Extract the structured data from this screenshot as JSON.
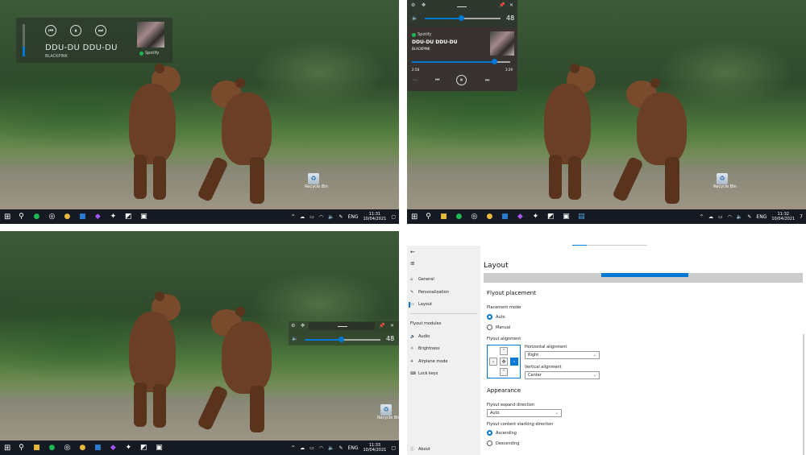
{
  "media": {
    "title": "DDU-DU DDU-DU",
    "artist": "BLACKPINK",
    "source": "Spotify",
    "time_elapsed": "2:58",
    "time_total": "3:29",
    "volume_value": "48",
    "volume_level": 0.48,
    "progress_level": 0.84
  },
  "desktop": {
    "recycle_label": "Recycle Bin"
  },
  "taskbar": {
    "lang": "ENG",
    "time1": "11:31",
    "time2": "11:32",
    "time3": "11:33",
    "date": "10/04/2021",
    "notif_count": "7"
  },
  "settings": {
    "nav": [
      {
        "label": "General",
        "icon": "home-icon"
      },
      {
        "label": "Personalization",
        "icon": "brush-icon"
      },
      {
        "label": "Layout",
        "icon": "layout-icon"
      }
    ],
    "modules_heading": "Flyout modules",
    "modules": [
      {
        "label": "Audio",
        "icon": "speaker-icon"
      },
      {
        "label": "Brightness",
        "icon": "sun-icon"
      },
      {
        "label": "Airplane mode",
        "icon": "airplane-icon"
      },
      {
        "label": "Lock keys",
        "icon": "keyboard-icon"
      }
    ],
    "about": "About",
    "page_title": "Layout",
    "placement_heading": "Flyout placement",
    "placement_mode": "Placement mode",
    "opt_auto": "Auto",
    "opt_manual": "Manual",
    "alignment_label": "Flyout alignment",
    "h_align_label": "Horizontal alignment",
    "h_align_value": "Right",
    "v_align_label": "Vertical alignment",
    "v_align_value": "Center",
    "appearance_heading": "Appearance",
    "expand_label": "Flyout expand direction",
    "expand_value": "Auto",
    "stacking_label": "Flyout content stacking direction",
    "opt_ascending": "Ascending",
    "opt_descending": "Descending"
  }
}
